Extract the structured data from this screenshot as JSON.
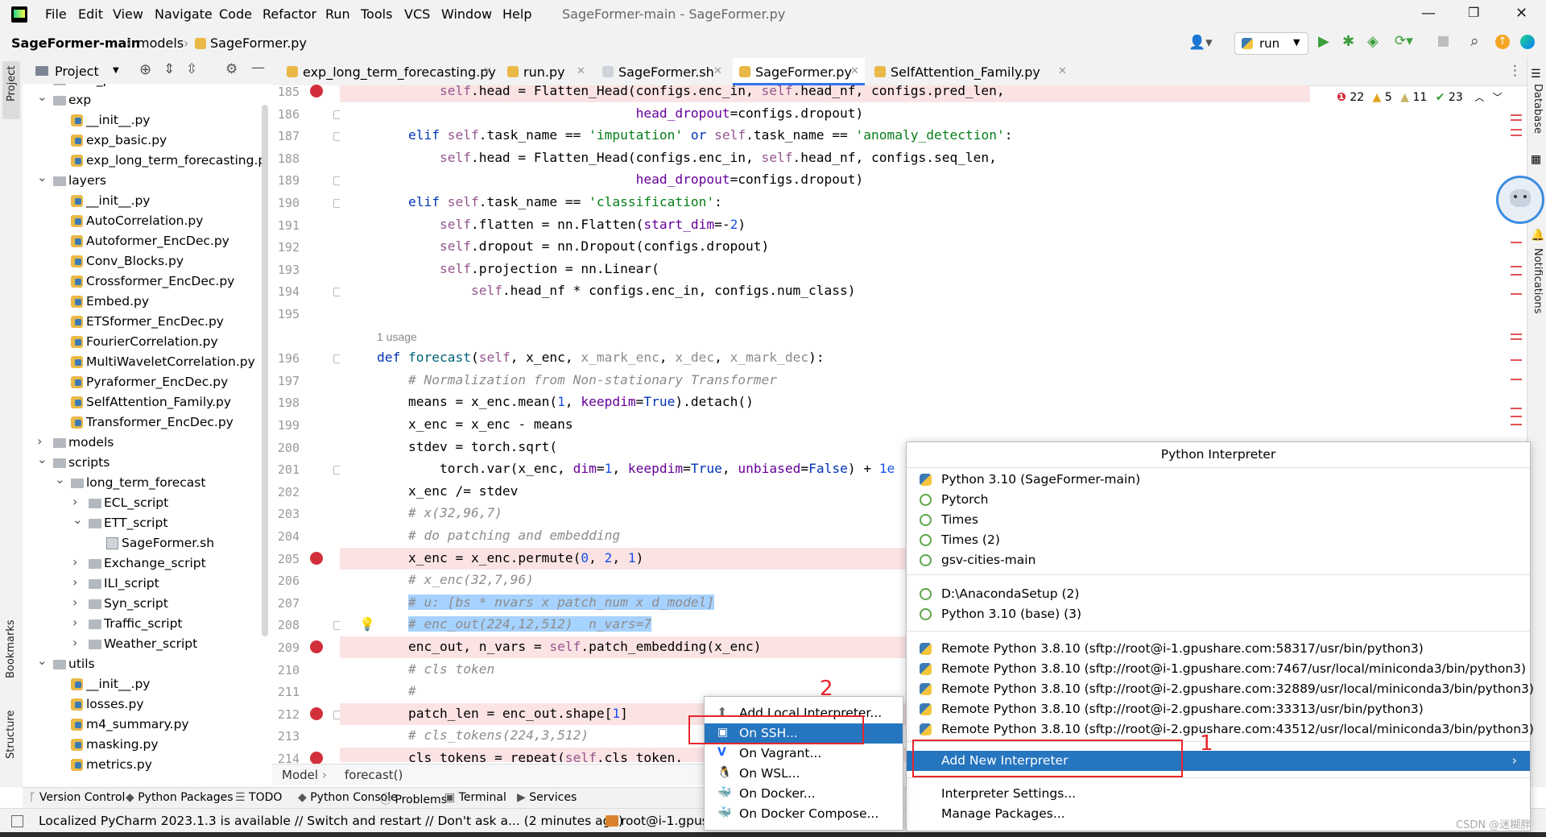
{
  "menu": {
    "items": [
      "File",
      "Edit",
      "View",
      "Navigate",
      "Code",
      "Refactor",
      "Run",
      "Tools",
      "VCS",
      "Window",
      "Help"
    ],
    "window_title": "SageFormer-main - SageFormer.py"
  },
  "nav": {
    "breadcrumb": [
      "SageFormer-main",
      "models",
      "SageFormer.py"
    ],
    "run_config": "run"
  },
  "project_panel": {
    "title": "Project",
    "tree": [
      {
        "label": "data_provider",
        "depth": 1,
        "type": "folder",
        "arrow": ""
      },
      {
        "label": "exp",
        "depth": 1,
        "type": "folder",
        "arrow": "down"
      },
      {
        "label": "__init__.py",
        "depth": 2,
        "type": "py",
        "arrow": ""
      },
      {
        "label": "exp_basic.py",
        "depth": 2,
        "type": "py",
        "arrow": ""
      },
      {
        "label": "exp_long_term_forecasting.p",
        "depth": 2,
        "type": "py",
        "arrow": ""
      },
      {
        "label": "layers",
        "depth": 1,
        "type": "folder",
        "arrow": "down"
      },
      {
        "label": "__init__.py",
        "depth": 2,
        "type": "py",
        "arrow": ""
      },
      {
        "label": "AutoCorrelation.py",
        "depth": 2,
        "type": "py",
        "arrow": ""
      },
      {
        "label": "Autoformer_EncDec.py",
        "depth": 2,
        "type": "py",
        "arrow": ""
      },
      {
        "label": "Conv_Blocks.py",
        "depth": 2,
        "type": "py",
        "arrow": ""
      },
      {
        "label": "Crossformer_EncDec.py",
        "depth": 2,
        "type": "py",
        "arrow": ""
      },
      {
        "label": "Embed.py",
        "depth": 2,
        "type": "py",
        "arrow": ""
      },
      {
        "label": "ETSformer_EncDec.py",
        "depth": 2,
        "type": "py",
        "arrow": ""
      },
      {
        "label": "FourierCorrelation.py",
        "depth": 2,
        "type": "py",
        "arrow": ""
      },
      {
        "label": "MultiWaveletCorrelation.py",
        "depth": 2,
        "type": "py",
        "arrow": ""
      },
      {
        "label": "Pyraformer_EncDec.py",
        "depth": 2,
        "type": "py",
        "arrow": ""
      },
      {
        "label": "SelfAttention_Family.py",
        "depth": 2,
        "type": "py",
        "arrow": ""
      },
      {
        "label": "Transformer_EncDec.py",
        "depth": 2,
        "type": "py",
        "arrow": ""
      },
      {
        "label": "models",
        "depth": 1,
        "type": "folder",
        "arrow": "right"
      },
      {
        "label": "scripts",
        "depth": 1,
        "type": "folder",
        "arrow": "down"
      },
      {
        "label": "long_term_forecast",
        "depth": 2,
        "type": "folder",
        "arrow": "down"
      },
      {
        "label": "ECL_script",
        "depth": 3,
        "type": "folder",
        "arrow": "right"
      },
      {
        "label": "ETT_script",
        "depth": 3,
        "type": "folder",
        "arrow": "down"
      },
      {
        "label": "SageFormer.sh",
        "depth": 4,
        "type": "sh",
        "arrow": ""
      },
      {
        "label": "Exchange_script",
        "depth": 3,
        "type": "folder",
        "arrow": "right"
      },
      {
        "label": "ILI_script",
        "depth": 3,
        "type": "folder",
        "arrow": "right"
      },
      {
        "label": "Syn_script",
        "depth": 3,
        "type": "folder",
        "arrow": "right"
      },
      {
        "label": "Traffic_script",
        "depth": 3,
        "type": "folder",
        "arrow": "right"
      },
      {
        "label": "Weather_script",
        "depth": 3,
        "type": "folder",
        "arrow": "right"
      },
      {
        "label": "utils",
        "depth": 1,
        "type": "folder",
        "arrow": "down"
      },
      {
        "label": "__init__.py",
        "depth": 2,
        "type": "py",
        "arrow": ""
      },
      {
        "label": "losses.py",
        "depth": 2,
        "type": "py",
        "arrow": ""
      },
      {
        "label": "m4_summary.py",
        "depth": 2,
        "type": "py",
        "arrow": ""
      },
      {
        "label": "masking.py",
        "depth": 2,
        "type": "py",
        "arrow": ""
      },
      {
        "label": "metrics.py",
        "depth": 2,
        "type": "py",
        "arrow": ""
      }
    ]
  },
  "tabs": [
    {
      "label": "exp_long_term_forecasting.py",
      "active": false
    },
    {
      "label": "run.py",
      "active": false
    },
    {
      "label": "SageFormer.sh",
      "active": false
    },
    {
      "label": "SageFormer.py",
      "active": true
    },
    {
      "label": "SelfAttention_Family.py",
      "active": false
    }
  ],
  "inspections": {
    "errors": "22",
    "warnings": "5",
    "weak": "11",
    "ok": "23"
  },
  "editor": {
    "usage_hint": "1 usage",
    "lines": [
      {
        "n": "185",
        "bp": true,
        "segs": [
          [
            "        ",
            ""
          ],
          [
            "self",
            "slf"
          ],
          [
            ".head = Flatten_Head(configs.enc_in, ",
            ""
          ],
          [
            "self",
            "slf"
          ],
          [
            ".head_nf, configs.pred_len,",
            ""
          ]
        ]
      },
      {
        "n": "186",
        "segs": [
          [
            "                                 ",
            ""
          ],
          [
            "head_dropout",
            "par"
          ],
          [
            "=configs.dropout)",
            ""
          ]
        ]
      },
      {
        "n": "187",
        "segs": [
          [
            "    ",
            ""
          ],
          [
            "elif ",
            "kw"
          ],
          [
            "self",
            "slf"
          ],
          [
            ".task_name == ",
            ""
          ],
          [
            "'imputation'",
            "str"
          ],
          [
            " or ",
            "kw"
          ],
          [
            "self",
            "slf"
          ],
          [
            ".task_name == ",
            ""
          ],
          [
            "'anomaly_detection'",
            "str"
          ],
          [
            ":",
            ""
          ]
        ]
      },
      {
        "n": "188",
        "segs": [
          [
            "        ",
            ""
          ],
          [
            "self",
            "slf"
          ],
          [
            ".head = Flatten_Head(configs.enc_in, ",
            ""
          ],
          [
            "self",
            "slf"
          ],
          [
            ".head_nf, configs.seq_len,",
            ""
          ]
        ]
      },
      {
        "n": "189",
        "segs": [
          [
            "                                 ",
            ""
          ],
          [
            "head_dropout",
            "par"
          ],
          [
            "=configs.dropout)",
            ""
          ]
        ]
      },
      {
        "n": "190",
        "segs": [
          [
            "    ",
            ""
          ],
          [
            "elif ",
            "kw"
          ],
          [
            "self",
            "slf"
          ],
          [
            ".task_name == ",
            ""
          ],
          [
            "'classification'",
            "str"
          ],
          [
            ":",
            ""
          ]
        ]
      },
      {
        "n": "191",
        "segs": [
          [
            "        ",
            ""
          ],
          [
            "self",
            "slf"
          ],
          [
            ".flatten = nn.Flatten(",
            ""
          ],
          [
            "start_dim",
            "par"
          ],
          [
            "=-",
            ""
          ],
          [
            "2",
            "num"
          ],
          [
            ")",
            ""
          ]
        ]
      },
      {
        "n": "192",
        "segs": [
          [
            "        ",
            ""
          ],
          [
            "self",
            "slf"
          ],
          [
            ".dropout = nn.Dropout(configs.dropout)",
            ""
          ]
        ]
      },
      {
        "n": "193",
        "segs": [
          [
            "        ",
            ""
          ],
          [
            "self",
            "slf"
          ],
          [
            ".projection = nn.Linear(",
            ""
          ]
        ]
      },
      {
        "n": "194",
        "segs": [
          [
            "            ",
            ""
          ],
          [
            "self",
            "slf"
          ],
          [
            ".head_nf * configs.enc_in, configs.num_class)",
            ""
          ]
        ]
      },
      {
        "n": "195",
        "segs": []
      },
      {
        "n": "196",
        "segs": [
          [
            "",
            ""
          ],
          [
            "def ",
            "kw"
          ],
          [
            "forecast",
            "fn"
          ],
          [
            "(",
            ""
          ],
          [
            "self",
            "slf"
          ],
          [
            ", x_enc, ",
            ""
          ],
          [
            "x_mark_enc",
            "cmt2"
          ],
          [
            ", ",
            ""
          ],
          [
            "x_dec",
            "cmt2"
          ],
          [
            ", ",
            ""
          ],
          [
            "x_mark_dec",
            "cmt2"
          ],
          [
            "):",
            ""
          ]
        ]
      },
      {
        "n": "197",
        "segs": [
          [
            "    ",
            ""
          ],
          [
            "# Normalization from Non-stationary Transformer",
            "cmt"
          ]
        ]
      },
      {
        "n": "198",
        "segs": [
          [
            "    means = x_enc.mean(",
            ""
          ],
          [
            "1",
            "num"
          ],
          [
            ", ",
            ""
          ],
          [
            "keepdim",
            "par"
          ],
          [
            "=",
            ""
          ],
          [
            "True",
            "kw"
          ],
          [
            ").detach()",
            ""
          ]
        ]
      },
      {
        "n": "199",
        "segs": [
          [
            "    x_enc = x_enc - means",
            ""
          ]
        ]
      },
      {
        "n": "200",
        "segs": [
          [
            "    stdev = torch.sqrt(",
            ""
          ]
        ]
      },
      {
        "n": "201",
        "segs": [
          [
            "        torch.var(x_enc, ",
            ""
          ],
          [
            "dim",
            "par"
          ],
          [
            "=",
            ""
          ],
          [
            "1",
            "num"
          ],
          [
            ", ",
            ""
          ],
          [
            "keepdim",
            "par"
          ],
          [
            "=",
            ""
          ],
          [
            "True",
            "kw"
          ],
          [
            ", ",
            ""
          ],
          [
            "unbiased",
            "par"
          ],
          [
            "=",
            ""
          ],
          [
            "False",
            "kw"
          ],
          [
            ") + ",
            ""
          ],
          [
            "1e",
            "num"
          ]
        ]
      },
      {
        "n": "202",
        "segs": [
          [
            "    x_enc /= stdev",
            ""
          ]
        ]
      },
      {
        "n": "203",
        "segs": [
          [
            "    ",
            ""
          ],
          [
            "# x(32,96,7)",
            "cmt"
          ]
        ]
      },
      {
        "n": "204",
        "segs": [
          [
            "    ",
            ""
          ],
          [
            "# do patching and embedding",
            "cmt"
          ]
        ]
      },
      {
        "n": "205",
        "bp": true,
        "segs": [
          [
            "    x_enc = x_enc.permute(",
            ""
          ],
          [
            "0",
            "num"
          ],
          [
            ", ",
            ""
          ],
          [
            "2",
            "num"
          ],
          [
            ", ",
            ""
          ],
          [
            "1",
            "num"
          ],
          [
            ")",
            ""
          ]
        ]
      },
      {
        "n": "206",
        "segs": [
          [
            "    ",
            ""
          ],
          [
            "# x_enc(32,7,96)",
            "cmt"
          ]
        ]
      },
      {
        "n": "207",
        "segs": [
          [
            "    ",
            ""
          ],
          [
            "# u: [bs * nvars x patch_num x d_model]",
            "cmt"
          ]
        ]
      },
      {
        "n": "208",
        "segs": [
          [
            "    ",
            ""
          ],
          [
            "# enc_out(224,12,512)  n_vars=7",
            "cmt"
          ]
        ]
      },
      {
        "n": "209",
        "bp": true,
        "segs": [
          [
            "    enc_out, n_vars = ",
            ""
          ],
          [
            "self",
            "slf"
          ],
          [
            ".patch_embedding(x_enc)",
            ""
          ]
        ]
      },
      {
        "n": "210",
        "segs": [
          [
            "    ",
            ""
          ],
          [
            "# cls token",
            "cmt"
          ]
        ]
      },
      {
        "n": "211",
        "segs": [
          [
            "    ",
            ""
          ],
          [
            "#",
            "cmt"
          ]
        ]
      },
      {
        "n": "212",
        "bp": true,
        "segs": [
          [
            "    patch_len = enc_out.shape[",
            ""
          ],
          [
            "1",
            "num"
          ],
          [
            "]",
            ""
          ]
        ]
      },
      {
        "n": "213",
        "segs": [
          [
            "    ",
            ""
          ],
          [
            "# cls_tokens(224,3,512)",
            "cmt"
          ]
        ]
      },
      {
        "n": "214",
        "bp": true,
        "segs": [
          [
            "    cls_tokens = repeat(",
            ""
          ],
          [
            "self",
            "slf"
          ],
          [
            ".cls_token, ",
            ""
          ]
        ]
      }
    ],
    "breadcrumb": [
      "Model",
      "forecast()"
    ]
  },
  "bottom_tools": [
    "Version Control",
    "Python Packages",
    "TODO",
    "Python Console",
    "Problems",
    "Terminal",
    "Services"
  ],
  "status": {
    "message": "Localized PyCharm 2023.1.3 is available // Switch and restart // Don't ask a... (2 minutes ago)",
    "remote": "root@i-1.gpus"
  },
  "interpreter_popup": {
    "title": "Python Interpreter",
    "group1": [
      {
        "label": "Python 3.10 (SageFormer-main)",
        "icon": "python-icon"
      },
      {
        "label": "Pytorch",
        "icon": "conda-icon"
      },
      {
        "label": "Times",
        "icon": "conda-icon"
      },
      {
        "label": "Times (2)",
        "icon": "conda-icon"
      },
      {
        "label": "gsv-cities-main",
        "icon": "conda-icon"
      }
    ],
    "group2": [
      {
        "label": "D:\\AnacondaSetup (2)",
        "icon": "conda-icon"
      },
      {
        "label": "Python 3.10 (base) (3)",
        "icon": "conda-icon"
      }
    ],
    "group3": [
      {
        "label": "Remote Python 3.8.10 (sftp://root@i-1.gpushare.com:58317/usr/bin/python3)",
        "icon": "python-icon"
      },
      {
        "label": "Remote Python 3.8.10 (sftp://root@i-1.gpushare.com:7467/usr/local/miniconda3/bin/python3)",
        "icon": "python-icon"
      },
      {
        "label": "Remote Python 3.8.10 (sftp://root@i-2.gpushare.com:32889/usr/local/miniconda3/bin/python3)",
        "icon": "python-icon"
      },
      {
        "label": "Remote Python 3.8.10 (sftp://root@i-2.gpushare.com:33313/usr/bin/python3)",
        "icon": "python-icon"
      },
      {
        "label": "Remote Python 3.8.10 (sftp://root@i-2.gpushare.com:43512/usr/local/miniconda3/bin/python3)",
        "icon": "python-icon"
      }
    ],
    "add_new": "Add New Interpreter",
    "settings": "Interpreter Settings...",
    "manage": "Manage Packages..."
  },
  "submenu": {
    "items": [
      {
        "label": "Add Local Interpreter...",
        "icon": "add-icon"
      },
      {
        "label": "On SSH...",
        "icon": "ssh-icon"
      },
      {
        "label": "On Vagrant...",
        "icon": "vagrant-icon"
      },
      {
        "label": "On WSL...",
        "icon": "linux-icon"
      },
      {
        "label": "On Docker...",
        "icon": "docker-icon"
      },
      {
        "label": "On Docker Compose...",
        "icon": "docker-icon"
      }
    ]
  },
  "annotations": {
    "marker1": "1",
    "marker2": "2"
  },
  "watermark": "CSDN @迷糊胖",
  "colors": {
    "accent": "#2675bf",
    "breakpoint": "#d32f3b",
    "annotation_red": "#e8262b"
  }
}
